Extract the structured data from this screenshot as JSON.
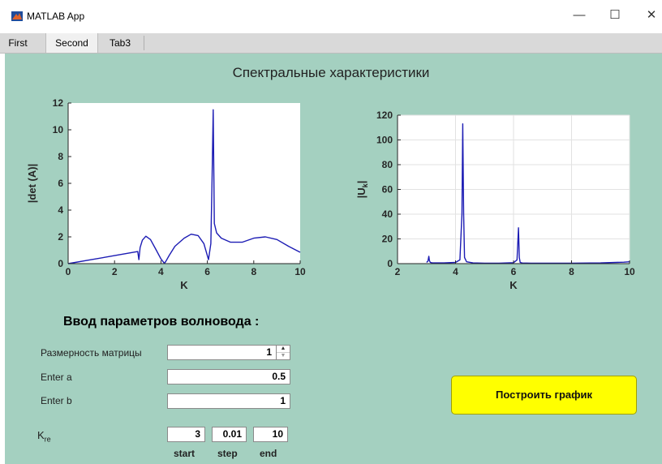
{
  "window": {
    "title": "MATLAB App",
    "icon": "matlab-logo-icon",
    "controls": [
      "minimize-icon",
      "maximize-icon",
      "close-icon"
    ]
  },
  "tabs": [
    {
      "label": "First",
      "active": false
    },
    {
      "label": "Second",
      "active": true
    },
    {
      "label": "Tab3",
      "active": false
    }
  ],
  "heading": "Спектральные характеристики",
  "panel_color": "#a4d0c0",
  "chart_data": [
    {
      "type": "line",
      "title": "",
      "xlabel": "K",
      "ylabel": "|det (A)|",
      "xlim": [
        0,
        10
      ],
      "ylim": [
        0,
        12
      ],
      "x_ticks": [
        "0",
        "2",
        "4",
        "6",
        "8",
        "10"
      ],
      "y_ticks": [
        "0",
        "2",
        "4",
        "6",
        "8",
        "10",
        "12"
      ],
      "grid": false,
      "series": [
        {
          "color": "#1c1cb4",
          "x": [
            0,
            1,
            2,
            2.5,
            3.0,
            3.05,
            3.1,
            3.2,
            3.35,
            3.55,
            3.8,
            4.0,
            4.15,
            4.22,
            4.35,
            4.6,
            5.0,
            5.3,
            5.6,
            5.85,
            6.05,
            6.15,
            6.2,
            6.25,
            6.3,
            6.4,
            6.6,
            7.0,
            7.5,
            8.0,
            8.5,
            9.0,
            9.5,
            10.0
          ],
          "y": [
            0,
            0.3,
            0.6,
            0.75,
            0.9,
            0.3,
            1.2,
            1.75,
            2.05,
            1.8,
            1.0,
            0.35,
            0.02,
            0.2,
            0.6,
            1.3,
            1.9,
            2.2,
            2.1,
            1.5,
            0.3,
            1.5,
            6.0,
            11.5,
            3.0,
            2.3,
            1.9,
            1.6,
            1.6,
            1.9,
            2.0,
            1.8,
            1.3,
            0.85
          ]
        }
      ]
    },
    {
      "type": "line",
      "title": "",
      "xlabel": "K",
      "ylabel": "|U",
      "ylabel_subscript": "k",
      "ylabel_suffix": "|",
      "xlim": [
        2,
        10
      ],
      "ylim": [
        0,
        120
      ],
      "x_ticks": [
        "2",
        "4",
        "6",
        "8",
        "10"
      ],
      "y_ticks": [
        "0",
        "20",
        "40",
        "60",
        "80",
        "100",
        "120"
      ],
      "grid": true,
      "series": [
        {
          "color": "#1c1cb4",
          "x": [
            3.0,
            3.05,
            3.08,
            3.1,
            3.13,
            3.2,
            3.6,
            4.0,
            4.15,
            4.22,
            4.25,
            4.28,
            4.31,
            4.38,
            4.6,
            5.0,
            5.5,
            6.0,
            6.12,
            6.17,
            6.2,
            6.23,
            6.3,
            6.6,
            7.0,
            8.0,
            9.0,
            9.8,
            10.0
          ],
          "y": [
            1.0,
            2.0,
            6.0,
            2.5,
            1.0,
            0.6,
            0.6,
            1.0,
            3.0,
            40,
            113,
            40,
            5.0,
            1.5,
            0.6,
            0.4,
            0.4,
            0.8,
            3.0,
            29,
            5.0,
            1.0,
            0.5,
            0.3,
            0.3,
            0.4,
            0.6,
            1.2,
            1.5
          ]
        }
      ]
    }
  ],
  "form": {
    "title": "Ввод параметров волновода :",
    "matrix_label": "Размерность матрицы",
    "matrix_value": "1",
    "a_label": "Enter a",
    "a_value": "0.5",
    "b_label": "Enter b",
    "b_value": "1",
    "kre_label_main": "K",
    "kre_label_sub": "re",
    "start_value": "3",
    "step_value": "0.01",
    "end_value": "10",
    "start_caption": "start",
    "step_caption": "step",
    "end_caption": "end"
  },
  "build_button": {
    "label": "Построить график",
    "color": "#ffff00"
  }
}
